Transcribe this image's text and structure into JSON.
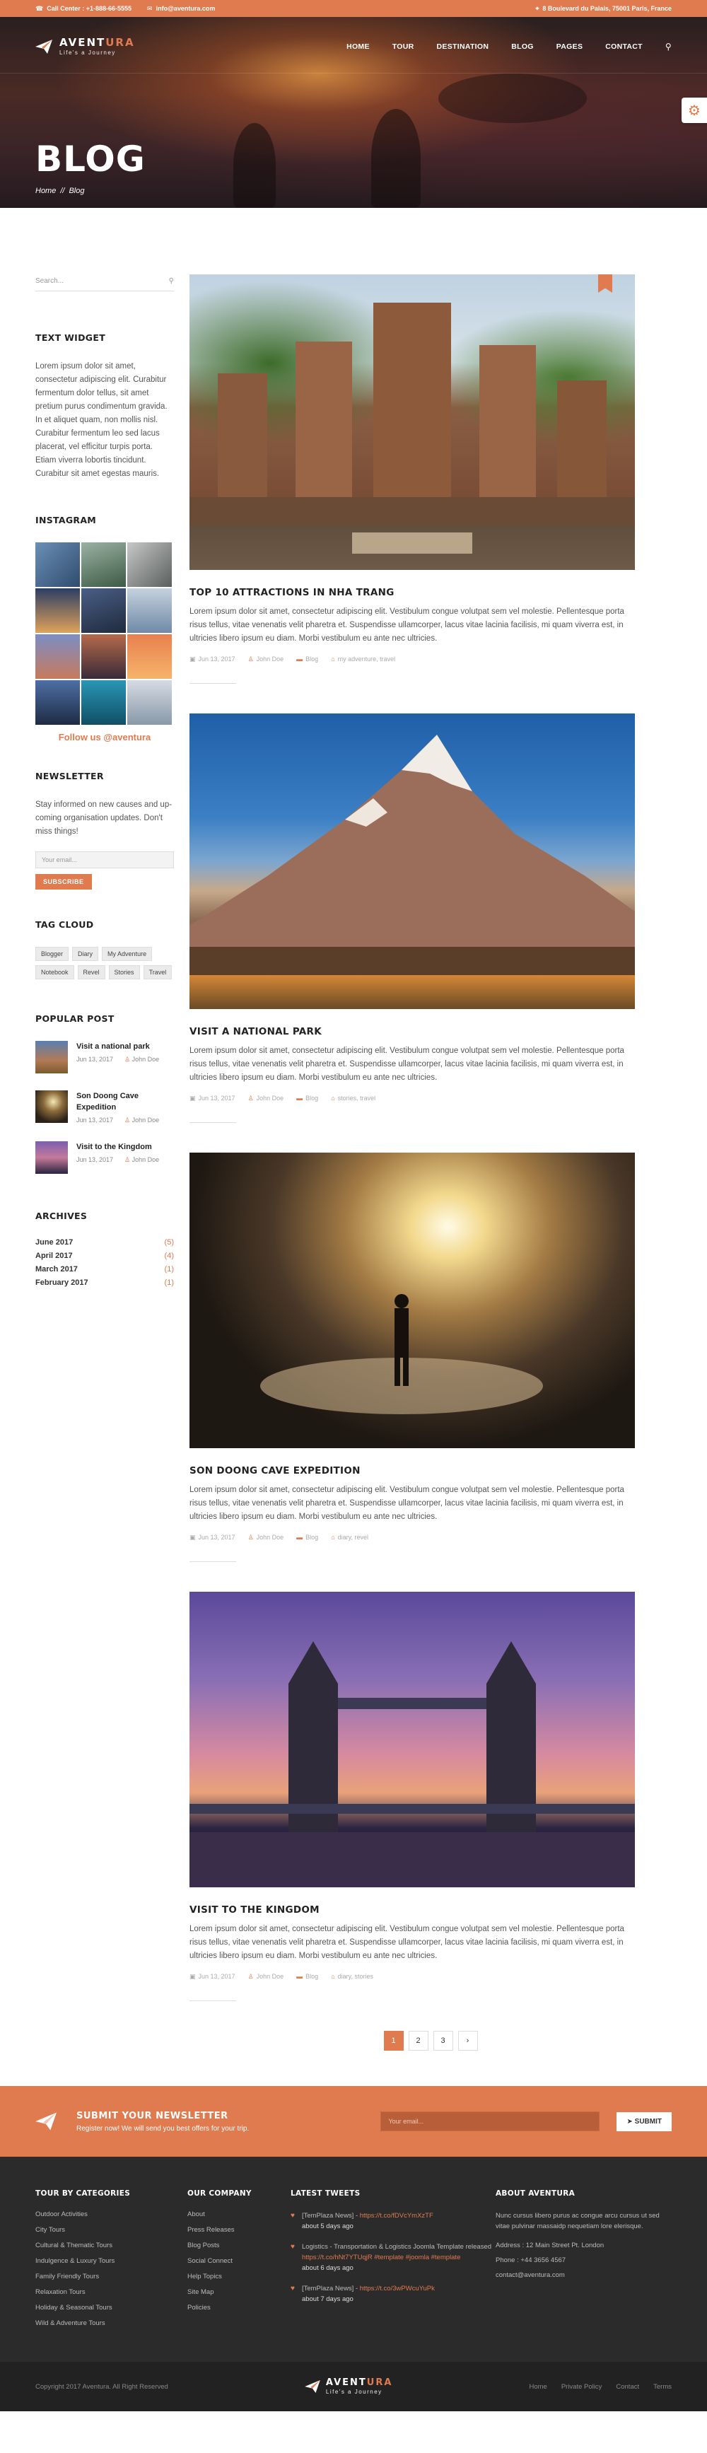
{
  "topbar": {
    "phone_label": "Call Center : +1-888-66-5555",
    "email_label": "info@aventura.com",
    "address_label": "8 Boulevard du Palais, 75001 Paris, France"
  },
  "brand": {
    "name_main": "AVENT",
    "name_accent": "URA",
    "tagline": "Life's a Journey"
  },
  "nav": {
    "items": [
      {
        "label": "HOME"
      },
      {
        "label": "TOUR"
      },
      {
        "label": "DESTINATION"
      },
      {
        "label": "BLOG"
      },
      {
        "label": "PAGES"
      },
      {
        "label": "CONTACT"
      }
    ]
  },
  "hero": {
    "title": "BLOG",
    "crumb_home": "Home",
    "crumb_sep": "//",
    "crumb_current": "Blog"
  },
  "sidebar": {
    "search_placeholder": "Search...",
    "text_widget": {
      "title": "TEXT WIDGET",
      "body": "Lorem ipsum dolor sit amet, consectetur adipiscing elit. Curabitur fermentum dolor tellus, sit amet pretium purus condimentum gravida. In et aliquet quam, non mollis nisl. Curabitur fermentum leo sed lacus placerat, vel efficitur turpis porta. Etiam viverra lobortis tincidunt. Curabitur sit amet egestas mauris."
    },
    "instagram": {
      "title": "INSTAGRAM",
      "follow_label": "Follow us @aventura"
    },
    "newsletter": {
      "title": "NEWSLETTER",
      "text": "Stay informed on new causes and up-coming organisation updates. Don't miss things!",
      "placeholder": "Your email...",
      "button": "SUBSCRIBE"
    },
    "tag_cloud": {
      "title": "TAG CLOUD",
      "tags": [
        "Blogger",
        "Diary",
        "My Adventure",
        "Notebook",
        "Revel",
        "Stories",
        "Travel"
      ]
    },
    "popular": {
      "title": "POPULAR POST",
      "posts": [
        {
          "title": "Visit a national park",
          "date": "Jun 13, 2017",
          "author": "John Doe"
        },
        {
          "title": "Son Doong Cave Expedition",
          "date": "Jun 13, 2017",
          "author": "John Doe"
        },
        {
          "title": "Visit to the Kingdom",
          "date": "Jun 13, 2017",
          "author": "John Doe"
        }
      ]
    },
    "archives": {
      "title": "ARCHIVES",
      "items": [
        {
          "month": "June 2017",
          "count": "(5)"
        },
        {
          "month": "April 2017",
          "count": "(4)"
        },
        {
          "month": "March 2017",
          "count": "(1)"
        },
        {
          "month": "February 2017",
          "count": "(1)"
        }
      ]
    }
  },
  "posts": [
    {
      "title": "TOP 10 ATTRACTIONS IN NHA TRANG",
      "excerpt": "Lorem ipsum dolor sit amet, consectetur adipiscing elit. Vestibulum congue volutpat sem vel molestie. Pellentesque porta risus tellus, vitae venenatis velit pharetra et. Suspendisse ullamcorper, lacus vitae lacinia facilisis, mi quam viverra est, in ultricies libero ipsum eu diam. Morbi vestibulum eu ante nec ultricies.",
      "date": "Jun 13, 2017",
      "author": "John Doe",
      "category": "Blog",
      "tags": "my adventure, travel"
    },
    {
      "title": "VISIT A NATIONAL PARK",
      "excerpt": "Lorem ipsum dolor sit amet, consectetur adipiscing elit. Vestibulum congue volutpat sem vel molestie. Pellentesque porta risus tellus, vitae venenatis velit pharetra et. Suspendisse ullamcorper, lacus vitae lacinia facilisis, mi quam viverra est, in ultricies libero ipsum eu diam. Morbi vestibulum eu ante nec ultricies.",
      "date": "Jun 13, 2017",
      "author": "John Doe",
      "category": "Blog",
      "tags": "stories, travel"
    },
    {
      "title": "SON DOONG CAVE EXPEDITION",
      "excerpt": "Lorem ipsum dolor sit amet, consectetur adipiscing elit. Vestibulum congue volutpat sem vel molestie. Pellentesque porta risus tellus, vitae venenatis velit pharetra et. Suspendisse ullamcorper, lacus vitae lacinia facilisis, mi quam viverra est, in ultricies libero ipsum eu diam. Morbi vestibulum eu ante nec ultricies.",
      "date": "Jun 13, 2017",
      "author": "John Doe",
      "category": "Blog",
      "tags": "diary, revel"
    },
    {
      "title": "VISIT TO THE KINGDOM",
      "excerpt": "Lorem ipsum dolor sit amet, consectetur adipiscing elit. Vestibulum congue volutpat sem vel molestie. Pellentesque porta risus tellus, vitae venenatis velit pharetra et. Suspendisse ullamcorper, lacus vitae lacinia facilisis, mi quam viverra est, in ultricies libero ipsum eu diam. Morbi vestibulum eu ante nec ultricies.",
      "date": "Jun 13, 2017",
      "author": "John Doe",
      "category": "Blog",
      "tags": "diary, stories"
    }
  ],
  "pagination": {
    "pages": [
      "1",
      "2",
      "3",
      "›"
    ],
    "current": "1"
  },
  "newsletter_band": {
    "title": "SUBMIT YOUR NEWSLETTER",
    "text": "Register now! We will send you best offers for your trip.",
    "placeholder": "Your email...",
    "button": "SUBMIT"
  },
  "footer": {
    "categories": {
      "title": "TOUR BY CATEGORIES",
      "items": [
        "Outdoor Activities",
        "City Tours",
        "Cultural & Thematic Tours",
        "Indulgence & Luxury Tours",
        "Family Friendly Tours",
        "Relaxation Tours",
        "Holiday & Seasonal Tours",
        "Wild & Adventure Tours"
      ]
    },
    "company": {
      "title": "OUR COMPANY",
      "items": [
        "About",
        "Press Releases",
        "Blog Posts",
        "Social Connect",
        "Help Topics",
        "Site Map",
        "Policies"
      ]
    },
    "tweets": {
      "title": "LATEST TWEETS",
      "items": [
        {
          "text": "[TemPlaza News] - ",
          "link": "https://t.co/fDVcYmXzTF",
          "ago": "about 5 days ago"
        },
        {
          "text": "Logistics - Transportation & Logistics Joomla Template released ",
          "link": "https://t.co/hNt7YTUqjR #template #joomla #template",
          "ago": "about 6 days ago"
        },
        {
          "text": "[TemPlaza News] - ",
          "link": "https://t.co/3wPWcuYuPk",
          "ago": "about 7 days ago"
        }
      ]
    },
    "about": {
      "title": "ABOUT AVENTURA",
      "text": "Nunc cursus libero purus ac congue arcu cursus ut sed vitae pulvinar massaidp nequetiam lore elerisque.",
      "address": "Address : 12 Main Street Pt. London",
      "phone": "Phone : +44 3656 4567",
      "email": "contact@aventura.com"
    }
  },
  "bottom": {
    "copyright": "Copyright 2017 Aventura. All Right Reserved",
    "links": [
      "Home",
      "Private Policy",
      "Contact",
      "Terms"
    ]
  },
  "colors": {
    "accent": "#e07a4f",
    "footer_bg": "#2b2b2b",
    "text": "#555555"
  },
  "icons": {
    "phone": "phone-icon",
    "email": "envelope-icon",
    "location": "pin-icon",
    "search": "search-icon",
    "settings": "gear-icon",
    "calendar": "calendar-icon",
    "user": "user-icon",
    "folder": "folder-icon",
    "tag": "tag-icon",
    "twitter": "twitter-icon"
  }
}
